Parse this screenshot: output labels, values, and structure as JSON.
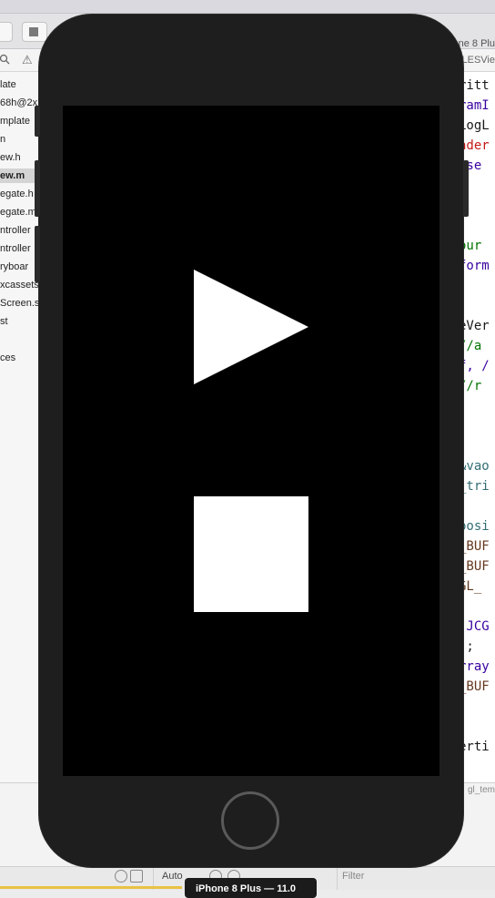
{
  "toolbar": {
    "scheme_label": "hone 8 Plu"
  },
  "jumpbar": {
    "file_label": "LESVie"
  },
  "navigator": {
    "items": [
      {
        "label": "late",
        "selected": false
      },
      {
        "label": "68h@2x",
        "selected": false
      },
      {
        "label": "mplate",
        "selected": false
      },
      {
        "label": "n",
        "selected": false
      },
      {
        "label": "ew.h",
        "selected": false
      },
      {
        "label": "ew.m",
        "selected": true
      },
      {
        "label": "egate.h",
        "selected": false
      },
      {
        "label": "egate.m",
        "selected": false
      },
      {
        "label": "ntroller",
        "selected": false
      },
      {
        "label": "ntroller",
        "selected": false
      },
      {
        "label": "ryboar",
        "selected": false
      },
      {
        "label": "xcassets",
        "selected": false
      },
      {
        "label": "Screen.s",
        "selected": false
      },
      {
        "label": "st",
        "selected": false
      },
      {
        "label": "",
        "selected": false
      },
      {
        "label": "ces",
        "selected": false
      }
    ]
  },
  "code": {
    "lines": [
      {
        "text": "ritt",
        "color": "#1a1a1a"
      },
      {
        "text": "ramI",
        "color": "#3900a0"
      },
      {
        "text": "LogL",
        "color": "#1a1a1a"
      },
      {
        "text": "ader",
        "color": "#c41a16"
      },
      {
        "text": "ase",
        "color": "#3900a0"
      },
      {
        "text": "",
        "color": "#1a1a1a"
      },
      {
        "text": "",
        "color": "#1a1a1a"
      },
      {
        "text": "",
        "color": "#1a1a1a"
      },
      {
        "text": "our",
        "color": "#007400"
      },
      {
        "text": "form",
        "color": "#3900a0"
      },
      {
        "text": "",
        "color": "#1a1a1a"
      },
      {
        "text": "",
        "color": "#1a1a1a"
      },
      {
        "text": "eVer",
        "color": "#1a1a1a"
      },
      {
        "text": " //a",
        "color": "#007400"
      },
      {
        "text": "f, /",
        "color": "#3900a0"
      },
      {
        "text": " //r",
        "color": "#007400"
      },
      {
        "text": "",
        "color": "#1a1a1a"
      },
      {
        "text": "",
        "color": "#1a1a1a"
      },
      {
        "text": "",
        "color": "#1a1a1a"
      },
      {
        "text": "&vao",
        "color": "#326d74"
      },
      {
        "text": "_tri",
        "color": "#326d74"
      },
      {
        "text": "",
        "color": "#1a1a1a"
      },
      {
        "text": "posi",
        "color": "#326d74"
      },
      {
        "text": "_BUF",
        "color": "#643820"
      },
      {
        "text": "_BUF",
        "color": "#643820"
      },
      {
        "text": " GL_",
        "color": "#643820"
      },
      {
        "text": "",
        "color": "#1a1a1a"
      },
      {
        "text": "(JCG",
        "color": "#3900a0"
      },
      {
        "text": ");",
        "color": "#1a1a1a"
      },
      {
        "text": "rray",
        "color": "#3900a0"
      },
      {
        "text": "_BUF",
        "color": "#643820"
      },
      {
        "text": "",
        "color": "#1a1a1a"
      },
      {
        "text": "",
        "color": "#1a1a1a"
      },
      {
        "text": "erti",
        "color": "#1a1a1a"
      }
    ]
  },
  "editor_footer": {
    "file_label": "gl_tem"
  },
  "bottombar": {
    "auto_label": "Auto",
    "filter_placeholder": "Filter"
  },
  "hud": {
    "label": "iPhone 8 Plus — 11.0"
  },
  "simulator": {
    "screen_color": "#000000",
    "shape_color": "#ffffff",
    "shapes": [
      {
        "name": "triangle",
        "icon": "play-icon"
      },
      {
        "name": "square",
        "icon": "stop-icon"
      }
    ]
  }
}
